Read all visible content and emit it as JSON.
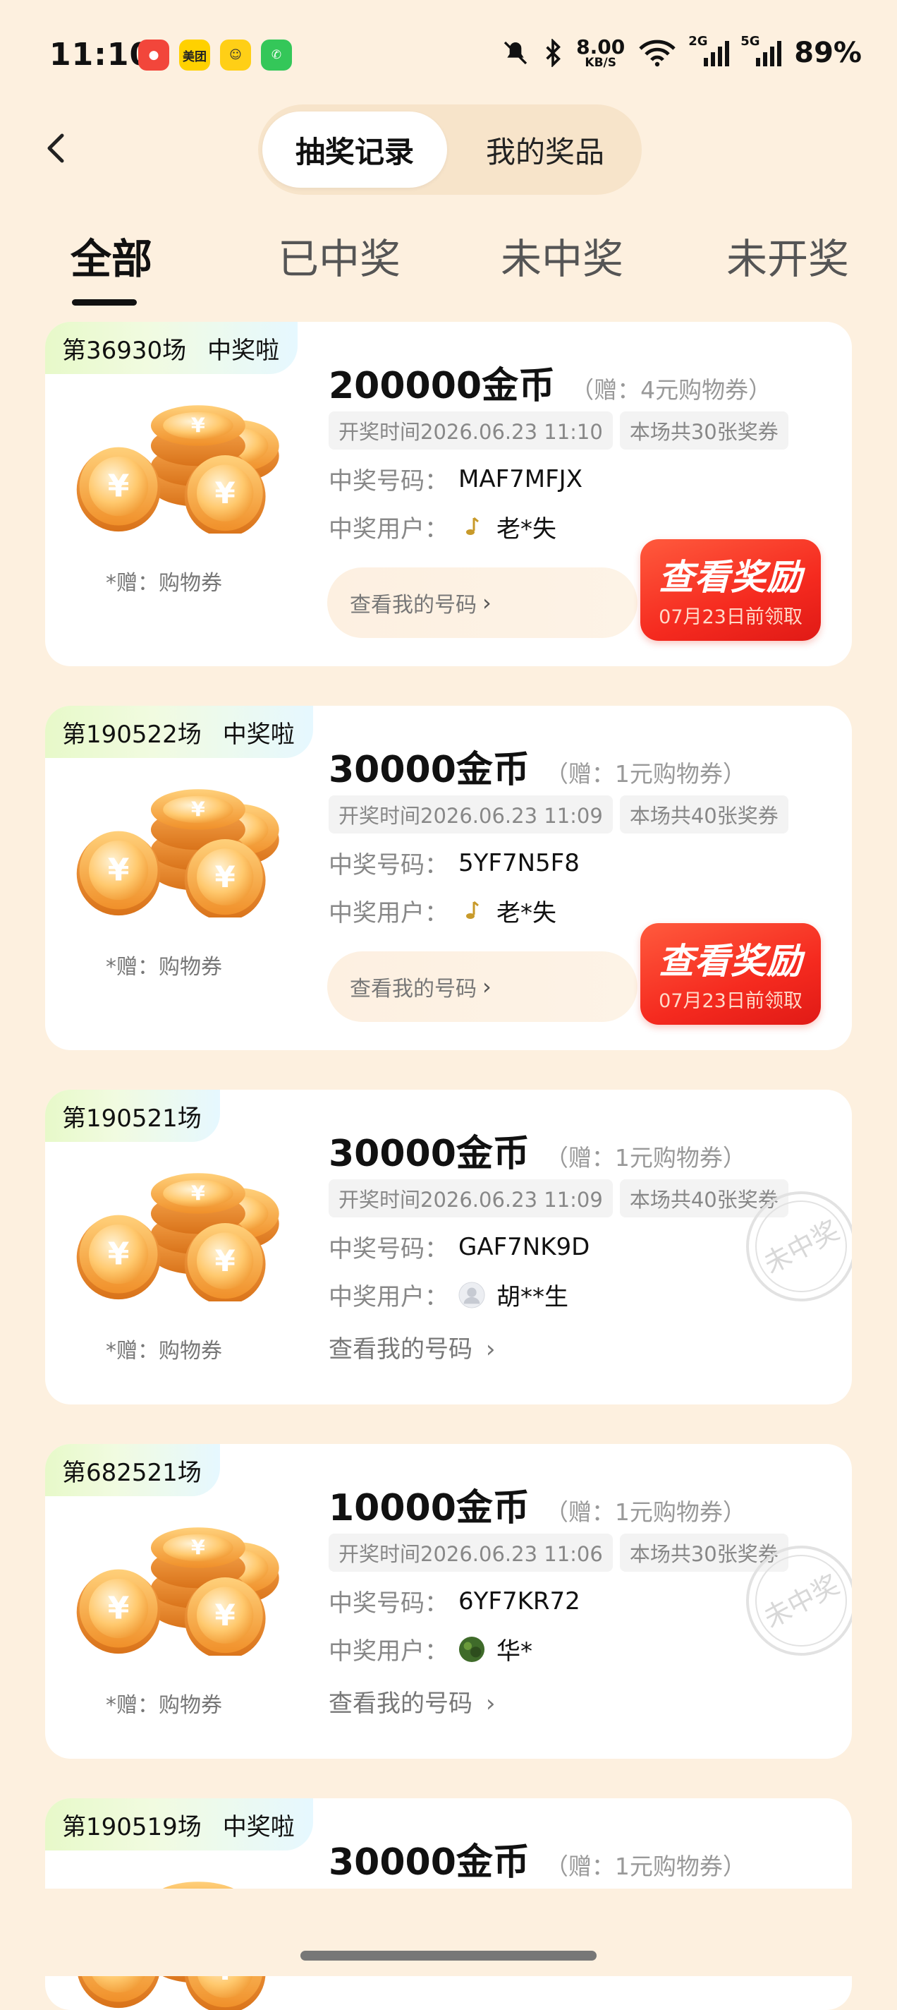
{
  "status_bar": {
    "time": "11:10",
    "apps": [
      {
        "icon": "app-icon-1",
        "label": "",
        "color": "#f44336"
      },
      {
        "icon": "meituan-icon",
        "label": "美团",
        "color": "#ffd100"
      },
      {
        "icon": "app-icon-3",
        "label": "",
        "color": "#ffcc00"
      },
      {
        "icon": "phone-icon",
        "label": "",
        "color": "#34c759"
      }
    ],
    "net_speed": "8.00",
    "net_unit": "KB/S",
    "sig_2g": "2G",
    "sig_5g": "5G",
    "battery": "89%"
  },
  "header": {
    "tabs": [
      {
        "label": "抽奖记录",
        "active": true
      },
      {
        "label": "我的奖品",
        "active": false
      }
    ]
  },
  "filter_tabs": [
    {
      "label": "全部",
      "active": true
    },
    {
      "label": "已中奖",
      "active": false
    },
    {
      "label": "未中奖",
      "active": false
    },
    {
      "label": "未开奖",
      "active": false
    }
  ],
  "labels": {
    "gift_note": "*赠：购物券",
    "win_code": "中奖号码：",
    "win_user": "中奖用户：",
    "my_code": "查看我的号码",
    "chevron": "›",
    "reward_title": "查看奖励",
    "won_tag": "中奖啦",
    "stamp_text": "未中奖"
  },
  "records": [
    {
      "session": "第36930场",
      "won": true,
      "amount": "200000金币",
      "bonus": "（赠：4元购物券）",
      "draw_time": "开奖时间2026.06.23 11:10",
      "tickets": "本场共30张奖券",
      "code": "MAF7MFJX",
      "user": "老*失",
      "user_avatar": "music-note-icon",
      "reward_deadline": "07月23日前领取"
    },
    {
      "session": "第190522场",
      "won": true,
      "amount": "30000金币",
      "bonus": "（赠：1元购物券）",
      "draw_time": "开奖时间2026.06.23 11:09",
      "tickets": "本场共40张奖券",
      "code": "5YF7N5F8",
      "user": "老*失",
      "user_avatar": "music-note-icon",
      "reward_deadline": "07月23日前领取"
    },
    {
      "session": "第190521场",
      "won": false,
      "amount": "30000金币",
      "bonus": "（赠：1元购物券）",
      "draw_time": "开奖时间2026.06.23 11:09",
      "tickets": "本场共40张奖券",
      "code": "GAF7NK9D",
      "user": "胡**生",
      "user_avatar": "default-avatar-icon"
    },
    {
      "session": "第682521场",
      "won": false,
      "amount": "10000金币",
      "bonus": "（赠：1元购物券）",
      "draw_time": "开奖时间2026.06.23 11:06",
      "tickets": "本场共30张奖券",
      "code": "6YF7KR72",
      "user": "华*",
      "user_avatar": "photo-avatar-icon"
    },
    {
      "session": "第190519场",
      "won": true,
      "amount": "30000金币",
      "bonus": "（赠：1元购物券）"
    }
  ]
}
